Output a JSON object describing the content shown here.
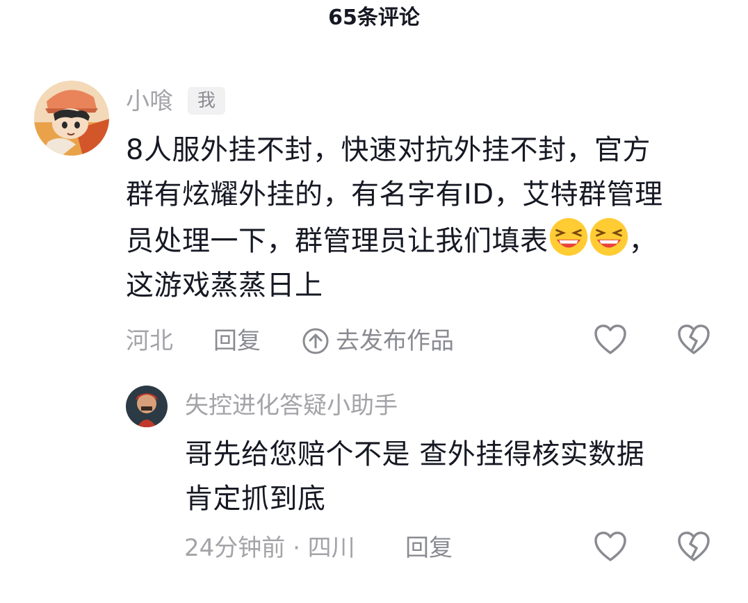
{
  "header": {
    "title": "65条评论"
  },
  "comment": {
    "author": "小喰",
    "author_badge": "我",
    "text_lines": [
      "8人服外挂不封，快速对抗外挂不封，官方",
      "群有炫耀外挂的，有名字有ID，艾特群管理",
      "员处理一下，群管理员让我们填表",
      "，",
      "这游戏蒸蒸日上"
    ],
    "emoji": [
      "laughing-emoji",
      "laughing-emoji"
    ],
    "location": "河北",
    "reply_label": "回复",
    "goto_work_label": "去发布作品",
    "icons": {
      "like": "heart-outline-icon",
      "dislike": "broken-heart-icon",
      "goto": "arrow-up-circle-icon"
    }
  },
  "reply": {
    "author": "失控进化答疑小助手",
    "text_lines": [
      "哥先给您赔个不是 查外挂得核实数据",
      "肯定抓到底"
    ],
    "time_location": "24分钟前 · 四川",
    "reply_label": "回复"
  },
  "colors": {
    "text_primary": "#161823",
    "text_secondary": "#a3a3a8",
    "badge_bg": "#f1f1f2"
  }
}
